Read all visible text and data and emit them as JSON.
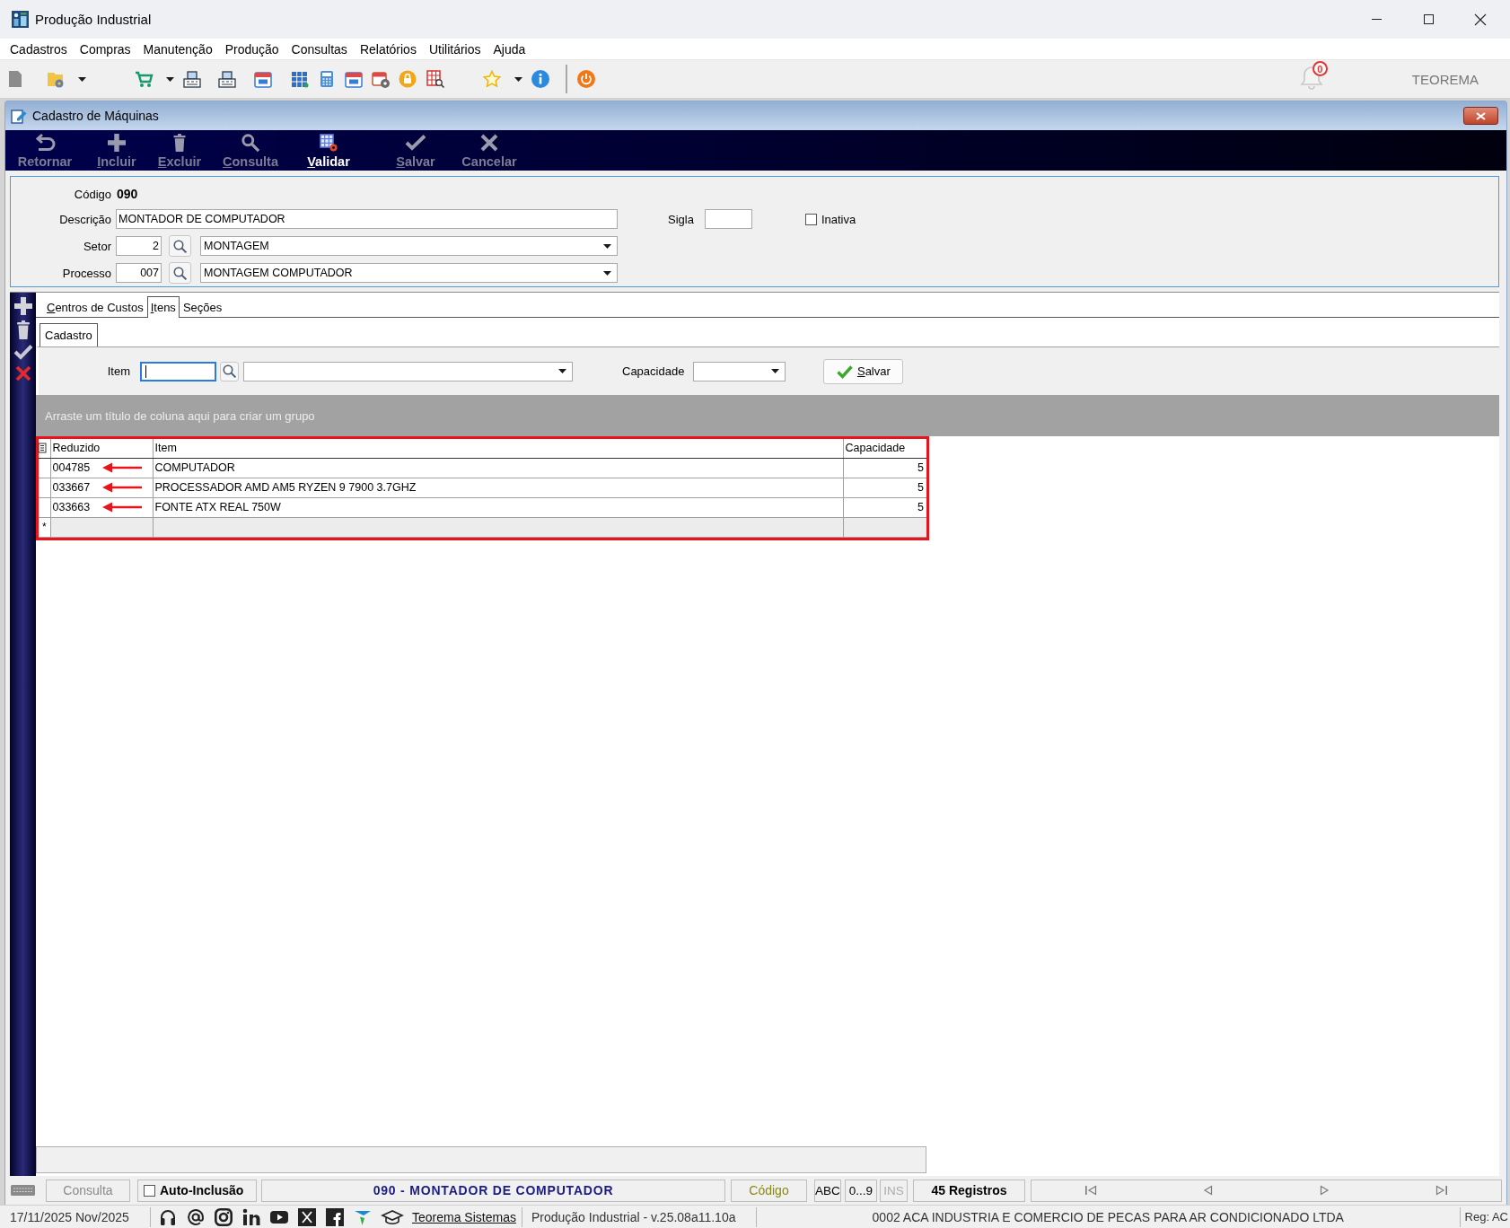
{
  "window": {
    "title": "Produção Industrial"
  },
  "menu": [
    "Cadastros",
    "Compras",
    "Manutenção",
    "Produção",
    "Consultas",
    "Relatórios",
    "Utilitários",
    "Ajuda"
  ],
  "toolbar": {
    "notification_count": "0",
    "brand": "TEOREMA"
  },
  "child_window": {
    "title": "Cadastro de Máquinas",
    "actions": [
      {
        "kind": "undo",
        "label": "Retornar",
        "enabled": false,
        "mnemonic": false
      },
      {
        "kind": "add",
        "label": "Incluir",
        "enabled": false,
        "mnemonic": true
      },
      {
        "kind": "delete",
        "label": "Excluir",
        "enabled": false,
        "mnemonic": true
      },
      {
        "kind": "search",
        "label": "Consulta",
        "enabled": false,
        "mnemonic": true
      },
      {
        "kind": "validate",
        "label": "Validar",
        "enabled": true,
        "mnemonic": true
      },
      {
        "kind": "save",
        "label": "Salvar",
        "enabled": false,
        "mnemonic": true
      },
      {
        "kind": "cancel",
        "label": "Cancelar",
        "enabled": false,
        "mnemonic": false
      }
    ]
  },
  "form": {
    "codigo": {
      "label": "Código",
      "value": "090"
    },
    "descricao": {
      "label": "Descrição",
      "value": "MONTADOR DE COMPUTADOR"
    },
    "sigla": {
      "label": "Sigla"
    },
    "inativa": {
      "label": "Inativa",
      "checked": false
    },
    "setor": {
      "label": "Setor",
      "code": "2",
      "name": "MONTAGEM"
    },
    "processo": {
      "label": "Processo",
      "code": "007",
      "name": "MONTAGEM COMPUTADOR"
    }
  },
  "tabs": [
    {
      "label": "Centros de Custos",
      "selected": false,
      "mnemonic": true
    },
    {
      "label": "Itens",
      "selected": true,
      "mnemonic": true
    },
    {
      "label": "Seções",
      "selected": false,
      "mnemonic": false
    }
  ],
  "subtabs": [
    {
      "label": "Cadastro",
      "selected": true
    }
  ],
  "item_entry": {
    "item_label": "Item",
    "item_field": {
      "focused": true
    },
    "capacity_label": "Capacidade",
    "save_button": {
      "label": "Salvar",
      "mnemonic": true
    }
  },
  "grid": {
    "group_hint": "Arraste um título de coluna aqui para criar um grupo",
    "highlighted": true,
    "columns": [
      "Reduzido",
      "Item",
      "Capacidade"
    ],
    "rows": [
      {
        "cells": [
          "004785",
          "COMPUTADOR",
          "5"
        ],
        "marked": true
      },
      {
        "cells": [
          "033667",
          "PROCESSADOR AMD AM5 RYZEN 9 7900 3.7GHZ",
          "5"
        ],
        "marked": true
      },
      {
        "cells": [
          "033663",
          "FONTE ATX REAL 750W",
          "5"
        ],
        "marked": true
      }
    ],
    "new_row_marker": "*"
  },
  "status_bar": {
    "mode": "Consulta",
    "auto_inclusion": {
      "label": "Auto-Inclusão",
      "checked": false
    },
    "record": "090 - MONTADOR DE COMPUTADOR",
    "search_field": "Código",
    "indicators": [
      {
        "label": "ABC",
        "active": true
      },
      {
        "label": "0...9",
        "active": true
      },
      {
        "label": "INS",
        "active": false
      }
    ],
    "count": "45 Registros"
  },
  "footer": {
    "date": "17/11/2025 Nov/2025",
    "link": "Teorema Sistemas",
    "version": "Produção Industrial - v.25.08a11.10a",
    "company": "0002 ACA INDUSTRIA E COMERCIO DE PECAS PARA AR CONDICIONADO LTDA",
    "reg": "Reg: AC"
  }
}
